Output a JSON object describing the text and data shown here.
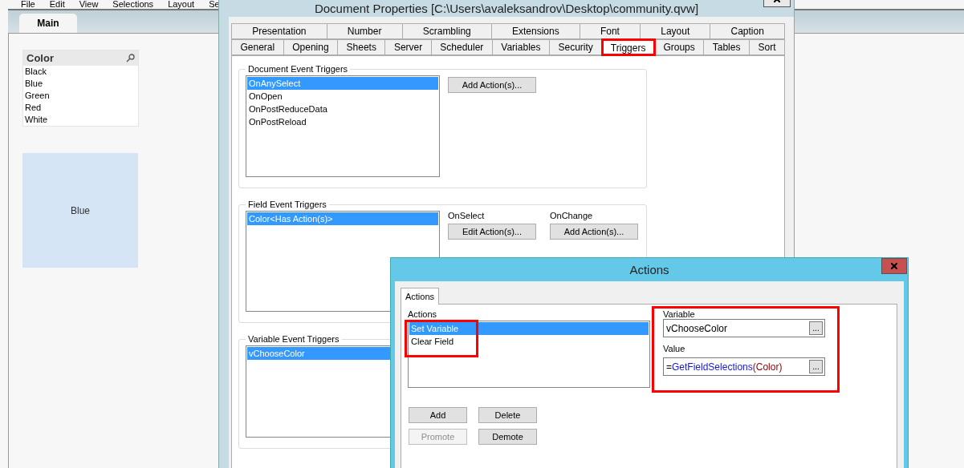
{
  "app": {
    "menu": [
      "File",
      "Edit",
      "View",
      "Selections",
      "Layout",
      "Se"
    ],
    "sheet_tabs": [
      {
        "label": "Main",
        "selected": true
      }
    ],
    "listbox": {
      "title": "Color",
      "items": [
        {
          "label": "Black",
          "selected": false
        },
        {
          "label": "Blue",
          "selected": false
        },
        {
          "label": "Green",
          "selected": false
        },
        {
          "label": "Red",
          "selected": false
        },
        {
          "label": "White",
          "selected": false
        }
      ]
    },
    "text_object": {
      "text": "Blue"
    }
  },
  "document_properties": {
    "title": "Document Properties [C:\\Users\\avaleksandrov\\Desktop\\community.qvw]",
    "tab_rows": [
      [
        {
          "label": "Presentation",
          "selected": false,
          "highlighted": false
        },
        {
          "label": "Number",
          "selected": false,
          "highlighted": false
        },
        {
          "label": "Scrambling",
          "selected": false,
          "highlighted": false
        },
        {
          "label": "Extensions",
          "selected": false,
          "highlighted": false
        },
        {
          "label": "Font",
          "selected": false,
          "highlighted": false
        },
        {
          "label": "Layout",
          "selected": false,
          "highlighted": false
        },
        {
          "label": "Caption",
          "selected": false,
          "highlighted": false
        }
      ],
      [
        {
          "label": "General",
          "selected": false,
          "highlighted": false
        },
        {
          "label": "Opening",
          "selected": false,
          "highlighted": false
        },
        {
          "label": "Sheets",
          "selected": false,
          "highlighted": false
        },
        {
          "label": "Server",
          "selected": false,
          "highlighted": false
        },
        {
          "label": "Scheduler",
          "selected": false,
          "highlighted": false
        },
        {
          "label": "Variables",
          "selected": false,
          "highlighted": false
        },
        {
          "label": "Security",
          "selected": false,
          "highlighted": false
        },
        {
          "label": "Triggers",
          "selected": true,
          "highlighted": true
        },
        {
          "label": "Groups",
          "selected": false,
          "highlighted": false
        },
        {
          "label": "Tables",
          "selected": false,
          "highlighted": false
        },
        {
          "label": "Sort",
          "selected": false,
          "highlighted": false
        }
      ]
    ],
    "document_event_triggers": {
      "title": "Document Event Triggers",
      "items": [
        {
          "label": "OnAnySelect",
          "selected": true
        },
        {
          "label": "OnOpen",
          "selected": false
        },
        {
          "label": "OnPostReduceData",
          "selected": false
        },
        {
          "label": "OnPostReload",
          "selected": false
        }
      ],
      "button": "Add Action(s)..."
    },
    "field_event_triggers": {
      "title": "Field Event Triggers",
      "items": [
        {
          "label": "Color<Has Action(s)>",
          "selected": true
        }
      ],
      "events": [
        {
          "label": "OnSelect",
          "button": "Edit Action(s)..."
        },
        {
          "label": "OnChange",
          "button": "Add Action(s)..."
        }
      ]
    },
    "variable_event_triggers": {
      "title": "Variable Event Triggers",
      "items": [
        {
          "label": "vChooseColor",
          "selected": true
        }
      ]
    }
  },
  "actions_dialog": {
    "title": "Actions",
    "tabs": [
      {
        "label": "Actions",
        "selected": true
      }
    ],
    "actions_label": "Actions",
    "actions": [
      {
        "label": "Set Variable",
        "selected": true
      },
      {
        "label": "Clear Field",
        "selected": false
      }
    ],
    "variable_label": "Variable",
    "variable_value": "vChooseColor",
    "variable_browse": "...",
    "value_label": "Value",
    "value_parts": [
      {
        "text": "=",
        "kind": "plain"
      },
      {
        "text": "GetFieldSelections",
        "kind": "function"
      },
      {
        "text": "(Color)",
        "kind": "field"
      }
    ],
    "value_browse": "...",
    "buttons": [
      {
        "label": "Add",
        "disabled": false
      },
      {
        "label": "Delete",
        "disabled": false
      },
      {
        "label": "Promote",
        "disabled": true
      },
      {
        "label": "Demote",
        "disabled": false
      }
    ]
  }
}
